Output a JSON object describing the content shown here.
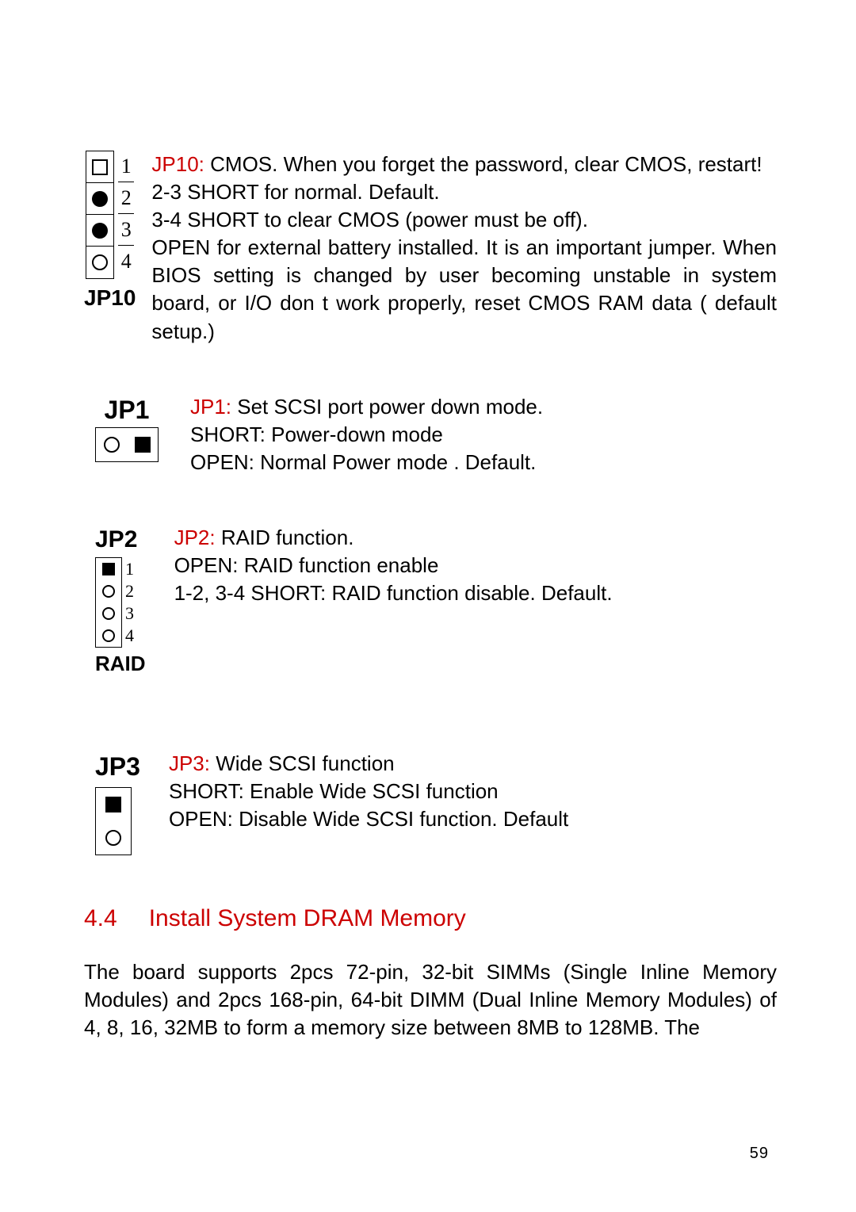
{
  "jp10": {
    "label": "JP10",
    "pins": [
      "1",
      "2",
      "3",
      "4"
    ],
    "label_red": "JP10:",
    "title_rest": " CMOS.   When you forget the password, clear CMOS, restart!",
    "line2": "2-3 SHORT for normal.  Default.",
    "line3": "3-4 SHORT to clear CMOS (power must be off).",
    "line4": "OPEN for external battery installed. It is an important jumper. When BIOS setting is changed by user becoming unstable in system board, or I/O don t work properly, reset CMOS RAM data ( default setup.)"
  },
  "jp1": {
    "label": "JP1",
    "label_red": "JP1:",
    "title_rest": " Set SCSI port power down mode.",
    "line2": "SHORT: Power-down mode",
    "line3": "OPEN: Normal Power mode  . Default."
  },
  "jp2": {
    "label": "JP2",
    "raid_label": "RAID",
    "pins": [
      "1",
      "2",
      "3",
      "4"
    ],
    "label_red": "JP2:",
    "title_rest": " RAID function.",
    "line2": "OPEN: RAID function enable",
    "line3": "1-2, 3-4 SHORT: RAID function disable.    Default."
  },
  "jp3": {
    "label": "JP3",
    "label_red": "JP3:",
    "title_rest": " Wide SCSI function",
    "line2": "SHORT: Enable Wide SCSI function",
    "line3": "OPEN: Disable Wide SCSI function.    Default"
  },
  "section": {
    "num": "4.4",
    "title": "Install System DRAM Memory",
    "para": "The board supports 2pcs 72-pin, 32-bit SIMMs (Single Inline Memory Modules) and 2pcs 168-pin, 64-bit DIMM (Dual Inline Memory Modules) of 4, 8, 16, 32MB to form a memory size between 8MB to 128MB. The"
  },
  "page_number": "59"
}
